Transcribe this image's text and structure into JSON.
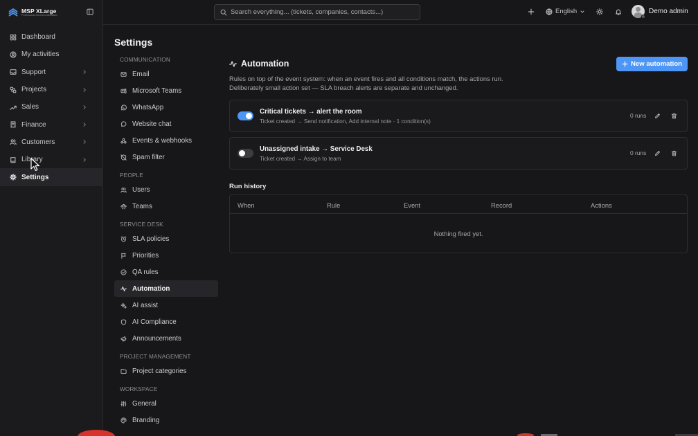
{
  "brand": {
    "name": "MSP XLarge",
    "subtitle": "Professional Services Automation"
  },
  "nav": {
    "items": [
      {
        "label": "Dashboard",
        "icon": "grid-icon",
        "chevron": false,
        "active": false
      },
      {
        "label": "My activities",
        "icon": "user-circle-icon",
        "chevron": false,
        "active": false
      },
      {
        "label": "Support",
        "icon": "inbox-icon",
        "chevron": true,
        "active": false
      },
      {
        "label": "Projects",
        "icon": "projects-icon",
        "chevron": true,
        "active": false
      },
      {
        "label": "Sales",
        "icon": "trending-icon",
        "chevron": true,
        "active": false
      },
      {
        "label": "Finance",
        "icon": "receipt-icon",
        "chevron": true,
        "active": false
      },
      {
        "label": "Customers",
        "icon": "users-icon",
        "chevron": true,
        "active": false
      },
      {
        "label": "Library",
        "icon": "book-icon",
        "chevron": true,
        "active": false
      },
      {
        "label": "Settings",
        "icon": "gear-icon",
        "chevron": false,
        "active": true
      }
    ]
  },
  "topbar": {
    "search_placeholder": "Search everything... (tickets, companies, contacts...)",
    "language": "English",
    "user": "Demo admin"
  },
  "settings": {
    "title": "Settings",
    "sections": [
      {
        "heading": "Communication",
        "items": [
          {
            "label": "Email",
            "icon": "mail-icon"
          },
          {
            "label": "Microsoft Teams",
            "icon": "teams-icon"
          },
          {
            "label": "WhatsApp",
            "icon": "whatsapp-icon"
          },
          {
            "label": "Website chat",
            "icon": "chat-bubble-icon"
          },
          {
            "label": "Events & webhooks",
            "icon": "webhook-icon"
          },
          {
            "label": "Spam filter",
            "icon": "shield-off-icon"
          }
        ]
      },
      {
        "heading": "People",
        "items": [
          {
            "label": "Users",
            "icon": "users-icon"
          },
          {
            "label": "Teams",
            "icon": "team-icon"
          }
        ]
      },
      {
        "heading": "Service Desk",
        "items": [
          {
            "label": "SLA policies",
            "icon": "alarm-clock-icon"
          },
          {
            "label": "Priorities",
            "icon": "flag-icon"
          },
          {
            "label": "QA rules",
            "icon": "check-circle-icon"
          },
          {
            "label": "Automation",
            "icon": "activity-icon",
            "active": true
          },
          {
            "label": "AI assist",
            "icon": "sparkles-icon"
          },
          {
            "label": "AI Compliance",
            "icon": "shield-icon"
          },
          {
            "label": "Announcements",
            "icon": "megaphone-icon"
          }
        ]
      },
      {
        "heading": "Project Management",
        "items": [
          {
            "label": "Project categories",
            "icon": "folder-icon"
          }
        ]
      },
      {
        "heading": "Workspace",
        "items": [
          {
            "label": "General",
            "icon": "sliders-icon"
          },
          {
            "label": "Branding",
            "icon": "palette-icon"
          }
        ]
      }
    ]
  },
  "automation": {
    "title": "Automation",
    "description_line1": "Rules on top of the event system: when an event fires and all conditions match, the actions run.",
    "description_line2": "Deliberately small action set — SLA breach alerts are separate and unchanged.",
    "new_button": "New automation",
    "rules": [
      {
        "name": "Critical tickets → alert the room",
        "summary": "Ticket created → Send notification, Add internal note · 1 condition(s)",
        "runs": "0 runs",
        "enabled": true
      },
      {
        "name": "Unassigned intake → Service Desk",
        "summary": "Ticket created → Assign to team",
        "runs": "0 runs",
        "enabled": false
      }
    ],
    "run_history": {
      "title": "Run history",
      "columns": [
        "When",
        "Rule",
        "Event",
        "Record",
        "Actions"
      ],
      "empty": "Nothing fired yet."
    }
  },
  "colors": {
    "accent": "#4d96f5",
    "background": "#17171a",
    "sidebar": "#1b1b1e"
  }
}
